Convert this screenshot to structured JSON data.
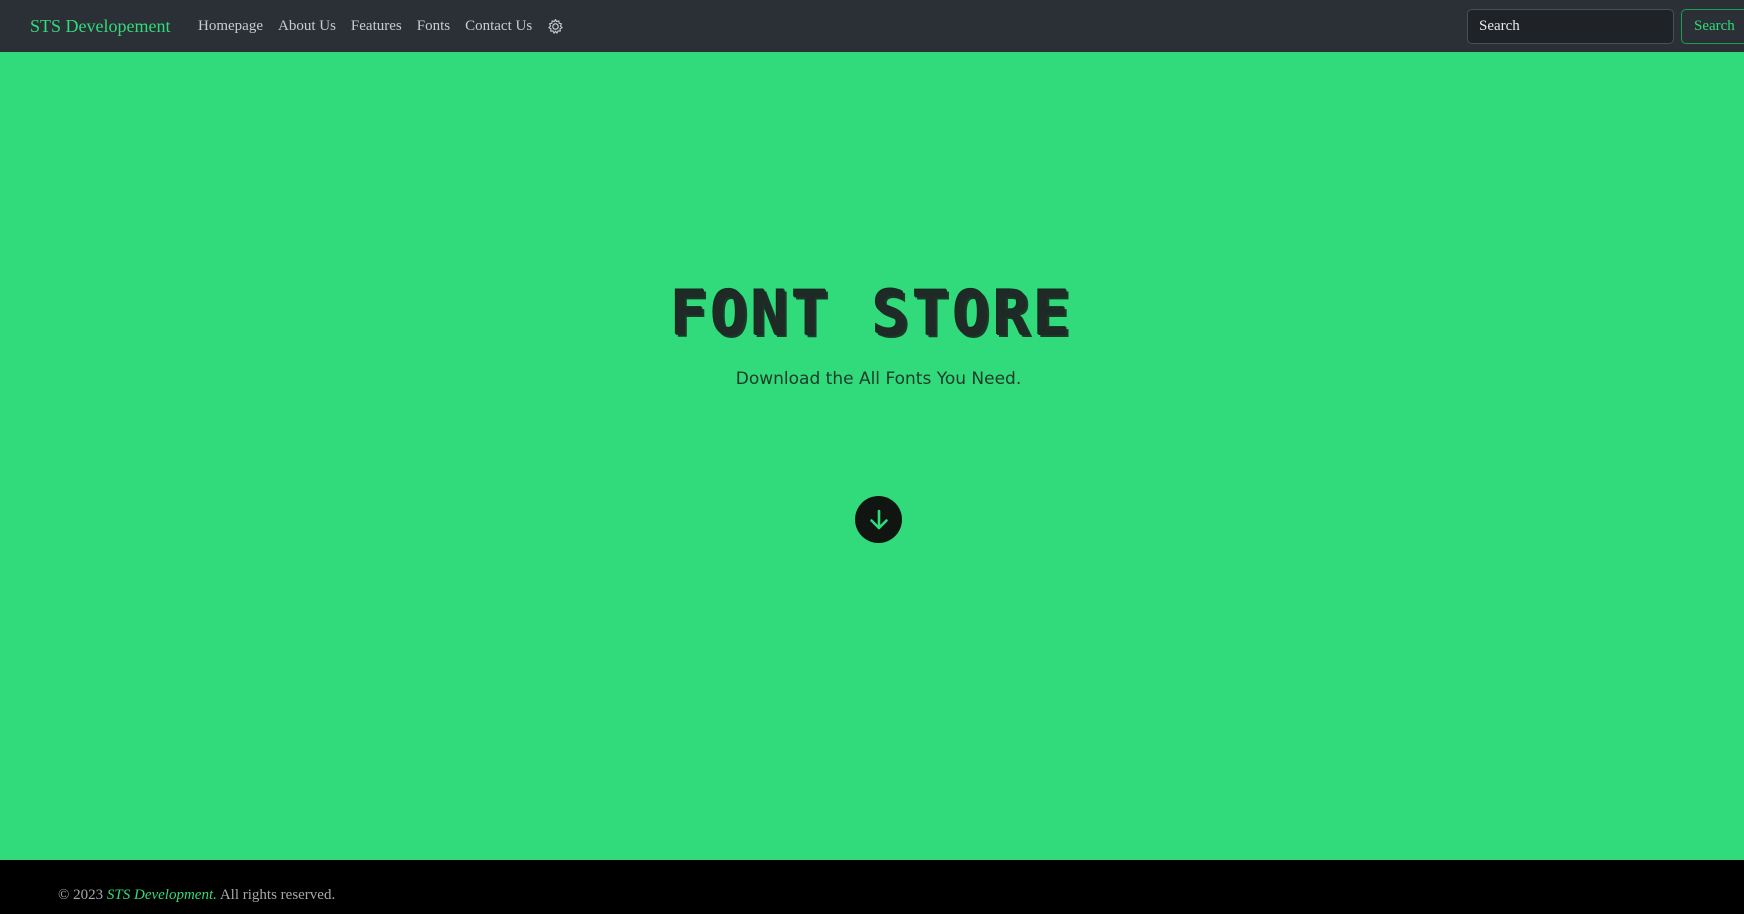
{
  "navbar": {
    "brand": "STS Developement",
    "links": [
      "Homepage",
      "About Us",
      "Features",
      "Fonts",
      "Contact Us"
    ],
    "settings_icon": "gear-icon",
    "search": {
      "placeholder": "Search",
      "button_label": "Search"
    }
  },
  "hero": {
    "title": "FONT STORE",
    "subtitle": "Download the All Fonts You Need.",
    "scroll_icon": "arrow-down-icon"
  },
  "footer": {
    "copyright": "© 2023",
    "brand": "STS Development.",
    "rights": "All rights reserved."
  },
  "colors": {
    "accent": "#31da7a",
    "navbar_bg": "#2b2f36",
    "footer_bg": "#000000",
    "button_dark": "#101512"
  }
}
